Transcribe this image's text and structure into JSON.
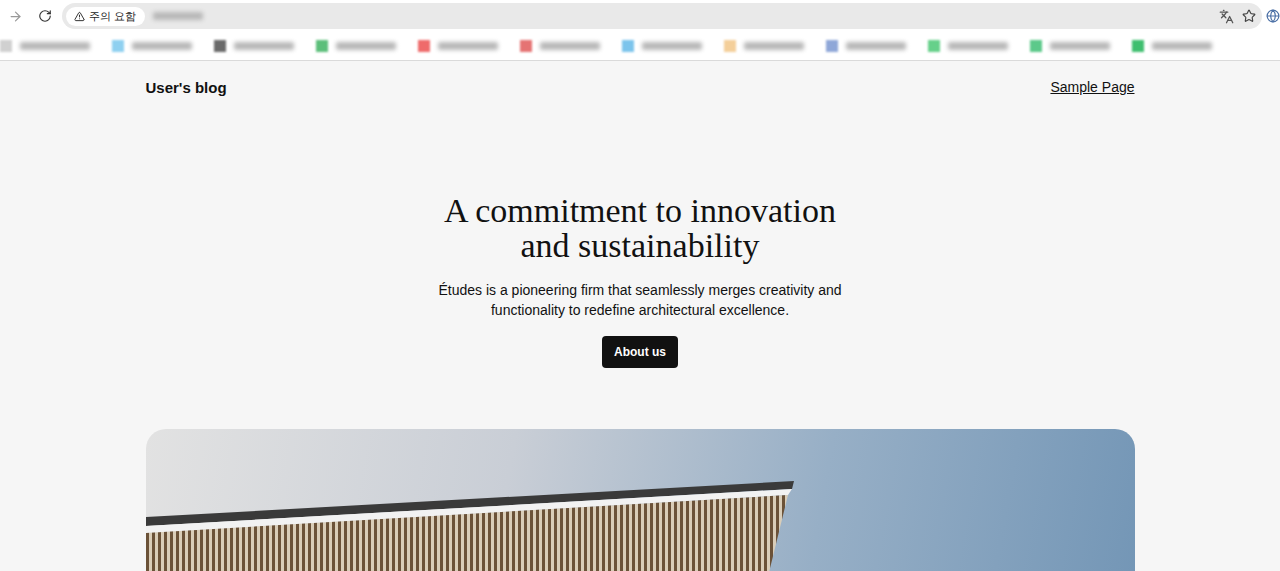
{
  "browser": {
    "security_chip": "주의 요함",
    "forward_disabled": true,
    "bookmarks": [
      {
        "color": "#d0d0d0"
      },
      {
        "color": "#8fd0f0"
      },
      {
        "color": "#6a6a6a"
      },
      {
        "color": "#5cbf7a"
      },
      {
        "color": "#ef6b6b"
      },
      {
        "color": "#e57373"
      },
      {
        "color": "#7cc4ec"
      },
      {
        "color": "#f4cf9a"
      },
      {
        "color": "#8fa7d8"
      },
      {
        "color": "#66d08a"
      },
      {
        "color": "#5cc98a"
      },
      {
        "color": "#3fbf6f"
      }
    ]
  },
  "page": {
    "site_title": "User's blog",
    "nav": [
      {
        "label": "Sample Page"
      }
    ],
    "hero": {
      "title": "A commitment to innovation and sustainability",
      "text": "Études is a pioneering firm that seamlessly merges creativity and functionality to redefine architectural excellence.",
      "button": "About us"
    }
  }
}
